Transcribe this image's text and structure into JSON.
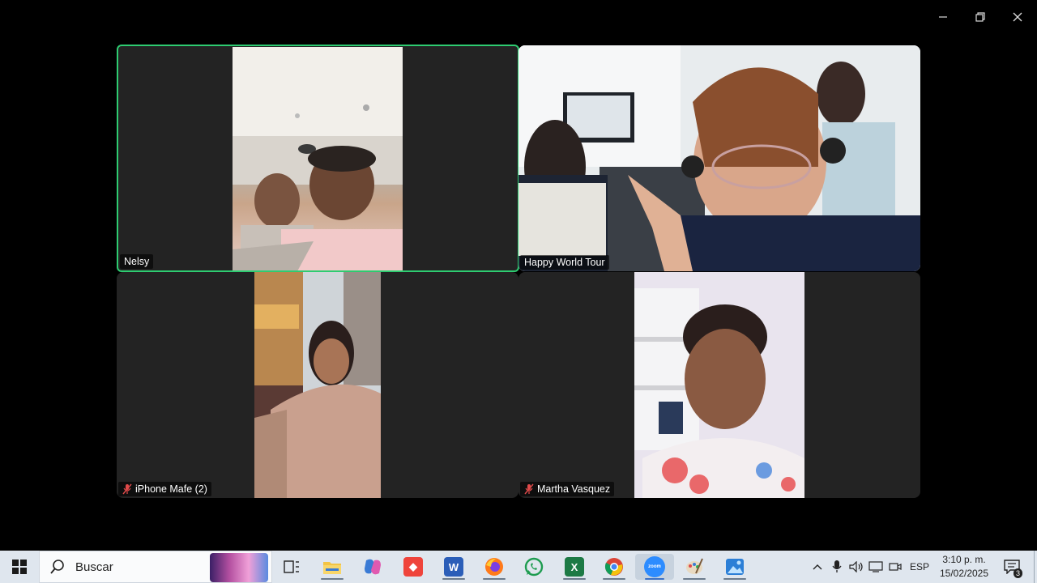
{
  "window": {
    "controls": [
      "minimize",
      "restore",
      "close"
    ]
  },
  "participants": [
    {
      "name": "Nelsy",
      "muted": false,
      "active_speaker": true
    },
    {
      "name": "Happy World Tour",
      "muted": false,
      "active_speaker": false
    },
    {
      "name": "iPhone Mafe (2)",
      "muted": true,
      "active_speaker": false
    },
    {
      "name": "Martha Vasquez",
      "muted": true,
      "active_speaker": false
    }
  ],
  "taskbar": {
    "search_placeholder": "Buscar",
    "apps": [
      "task-view",
      "file-explorer",
      "copilot",
      "anydesk",
      "word",
      "firefox",
      "whatsapp",
      "excel",
      "chrome",
      "zoom",
      "paint",
      "photos"
    ],
    "language": "ESP",
    "time": "3:10 p. m.",
    "date": "15/02/2025",
    "notification_count": "3"
  },
  "colors": {
    "active_speaker_border": "#2ecc71",
    "tile_bg": "#232323",
    "taskbar_bg": "#dfe6ee"
  }
}
